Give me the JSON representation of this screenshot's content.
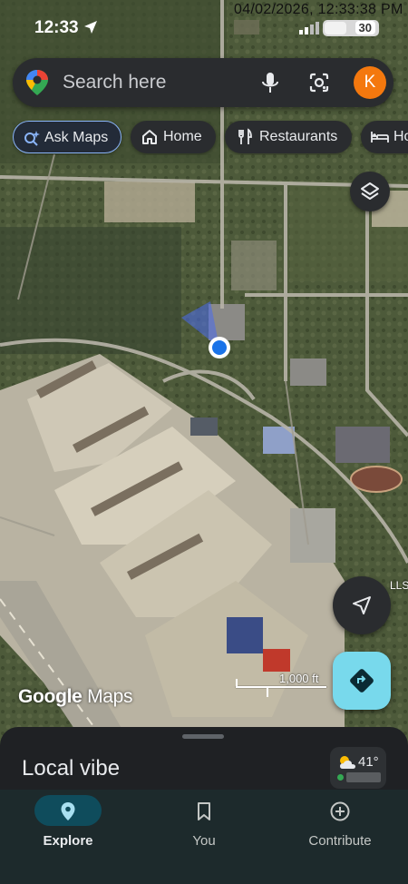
{
  "status_bar": {
    "time": "12:33",
    "timestamp": "04/02/2026, 12:33:38 PM",
    "battery": "30"
  },
  "search": {
    "placeholder": "Search here",
    "avatar_initial": "K"
  },
  "chips": [
    {
      "label": "Ask Maps",
      "icon": "sparkle-search-icon"
    },
    {
      "label": "Home",
      "icon": "home-icon"
    },
    {
      "label": "Restaurants",
      "icon": "fork-knife-icon"
    },
    {
      "label": "Ho",
      "icon": "bed-icon"
    }
  ],
  "map": {
    "scale_label": "1,000 ft",
    "attribution_google": "Google",
    "attribution_maps": "Maps",
    "partial_label": "LLS"
  },
  "sheet": {
    "title": "Local vibe",
    "weather_temp": "41°"
  },
  "nav": [
    {
      "label": "Explore",
      "icon": "pin-icon",
      "active": true
    },
    {
      "label": "You",
      "icon": "bookmark-icon",
      "active": false
    },
    {
      "label": "Contribute",
      "icon": "plus-circle-icon",
      "active": false
    }
  ],
  "colors": {
    "accent_blue": "#8ab4f8",
    "location_dot": "#1a73e8",
    "avatar": "#f4780e",
    "directions_button": "#78d9ec",
    "nav_active_pill": "#0f4c5c"
  }
}
